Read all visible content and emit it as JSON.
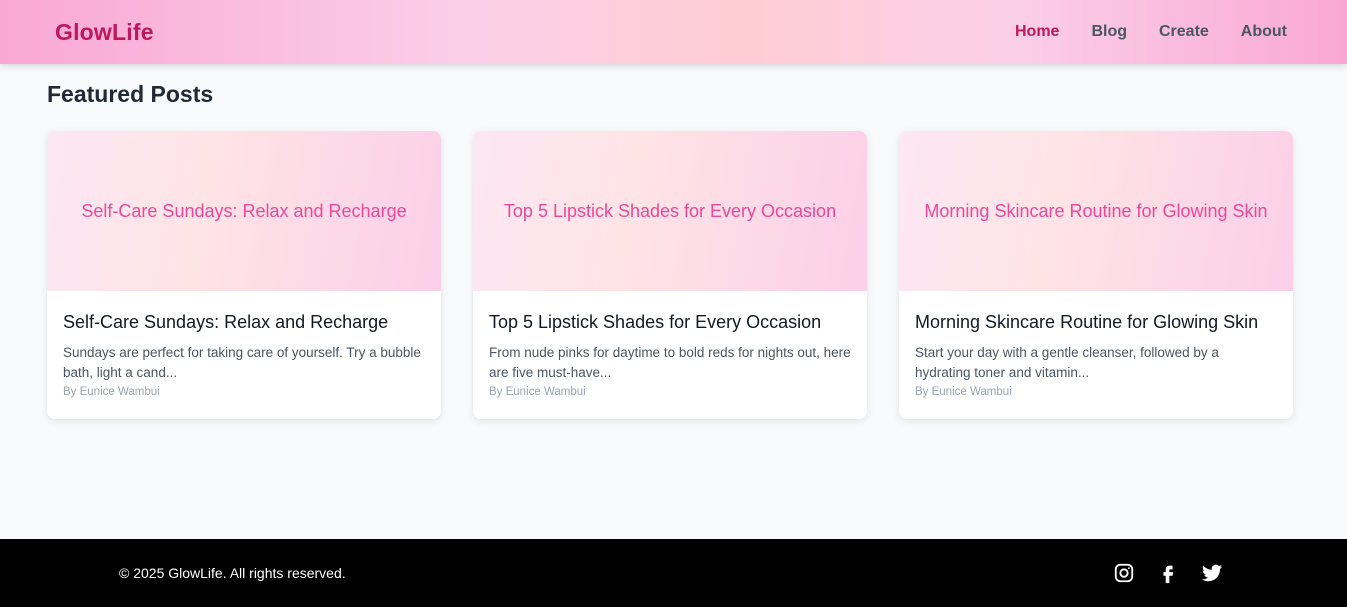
{
  "header": {
    "logo": "GlowLife",
    "nav": [
      {
        "label": "Home",
        "active": true
      },
      {
        "label": "Blog",
        "active": false
      },
      {
        "label": "Create",
        "active": false
      },
      {
        "label": "About",
        "active": false
      }
    ]
  },
  "main": {
    "section_title": "Featured Posts",
    "posts": [
      {
        "banner_text": "Self-Care Sundays: Relax and Recharge",
        "title": "Self-Care Sundays: Relax and Recharge",
        "excerpt": "Sundays are perfect for taking care of yourself. Try a bubble bath, light a cand...",
        "author": "By Eunice Wambui"
      },
      {
        "banner_text": "Top 5 Lipstick Shades for Every Occasion",
        "title": "Top 5 Lipstick Shades for Every Occasion",
        "excerpt": "From nude pinks for daytime to bold reds for nights out, here are five must-have...",
        "author": "By Eunice Wambui"
      },
      {
        "banner_text": "Morning Skincare Routine for Glowing Skin",
        "title": "Morning Skincare Routine for Glowing Skin",
        "excerpt": "Start your day with a gentle cleanser, followed by a hydrating toner and vitamin...",
        "author": "By Eunice Wambui"
      }
    ]
  },
  "footer": {
    "copyright": "© 2025 GlowLife. All rights reserved.",
    "social_icons": [
      "instagram-icon",
      "facebook-icon",
      "twitter-icon"
    ]
  },
  "colors": {
    "brand": "#be185d",
    "accent": "#ec4899",
    "footer_bg": "#000000"
  }
}
